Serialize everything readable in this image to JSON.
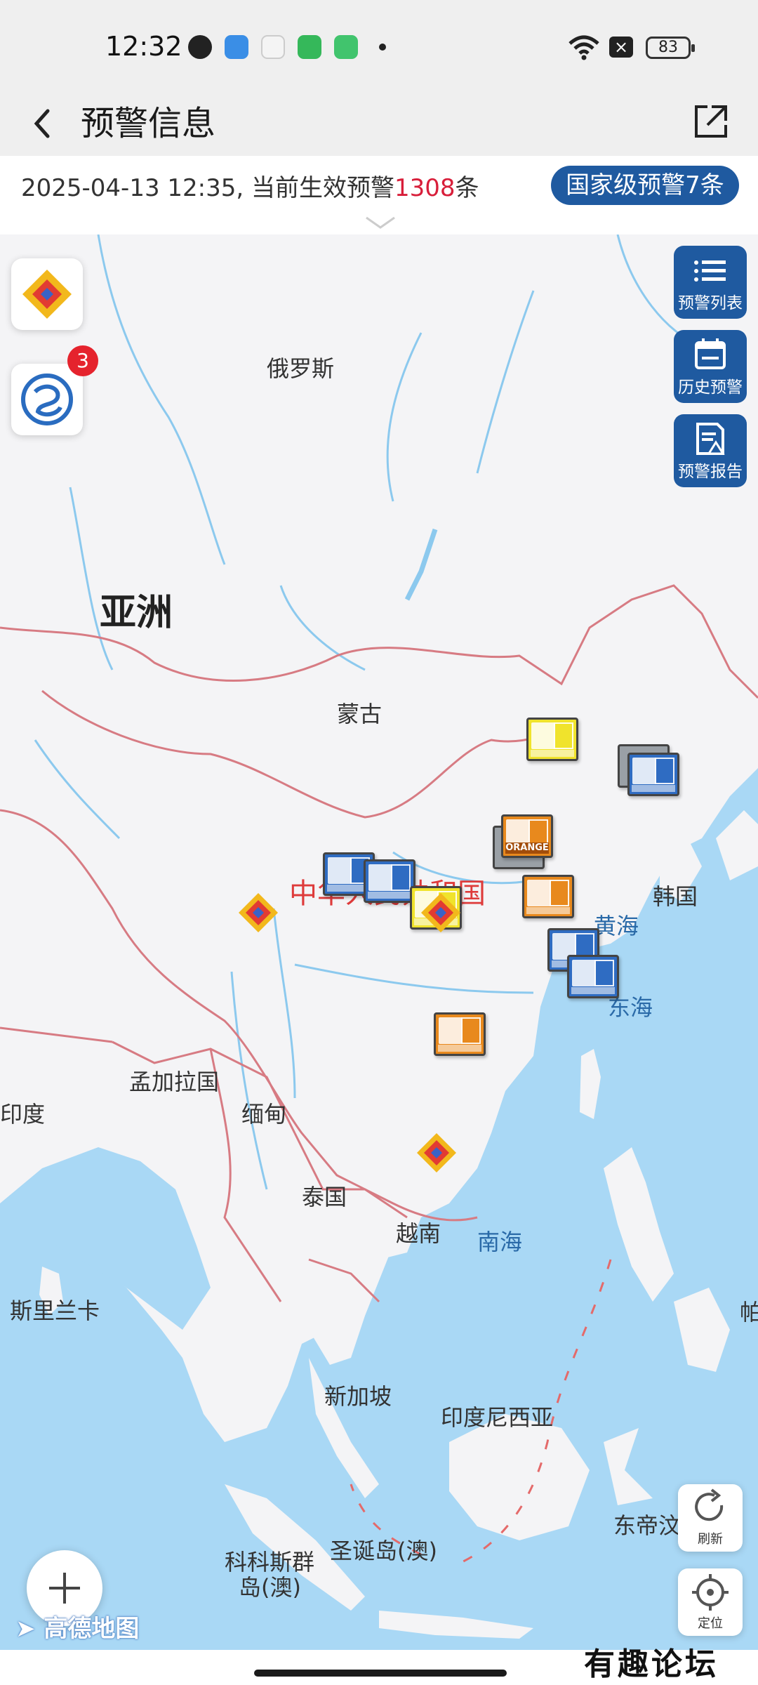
{
  "status_bar": {
    "time": "12:32",
    "battery": "83"
  },
  "header": {
    "title": "预警信息"
  },
  "info": {
    "datetime_prefix": "2025-04-13 12:35, 当前生效预警",
    "count": "1308",
    "suffix": "条",
    "national_button": "国家级预警7条"
  },
  "side_buttons": [
    {
      "label": "预警列表",
      "icon": "list-icon"
    },
    {
      "label": "历史预警",
      "icon": "calendar-icon"
    },
    {
      "label": "预警报告",
      "icon": "report-icon"
    }
  ],
  "badge_count": "3",
  "map": {
    "labels": {
      "russia": "俄罗斯",
      "asia": "亚洲",
      "mongolia": "蒙古",
      "china": "中华人民共和国",
      "korea": "韩国",
      "yellow_sea": "黄海",
      "east_sea": "东海",
      "bangladesh": "孟加拉国",
      "myanmar": "缅甸",
      "india": "印度",
      "thailand": "泰国",
      "vietnam": "越南",
      "south_sea": "南海",
      "sri_lanka": "斯里兰卡",
      "singapore": "新加坡",
      "indonesia": "印度尼西亚",
      "christmas": "圣诞岛(澳)",
      "cocos_1": "科科斯群",
      "cocos_2": "岛(澳)",
      "east_timor": "东帝汶",
      "pa": "帕"
    },
    "warnings": [
      {
        "type": "gale",
        "color": "yellow"
      },
      {
        "type": "snowstorm",
        "color": "blue"
      },
      {
        "type": "fire",
        "color": "orange",
        "text": "ORANGE"
      },
      {
        "type": "sea-gale",
        "color": "orange"
      },
      {
        "type": "frost",
        "color": "blue"
      },
      {
        "type": "gale",
        "color": "blue"
      },
      {
        "type": "gale",
        "color": "yellow"
      },
      {
        "type": "gale",
        "color": "blue"
      },
      {
        "type": "gale",
        "color": "blue"
      },
      {
        "type": "haze",
        "color": "orange"
      }
    ],
    "refresh_label": "刷新",
    "locate_label": "定位",
    "provider": "高德地图"
  },
  "watermark": "有趣论坛",
  "colors": {
    "accent": "#1f5aa0",
    "count": "#d81e3a",
    "sea": "#a9d8f5"
  }
}
